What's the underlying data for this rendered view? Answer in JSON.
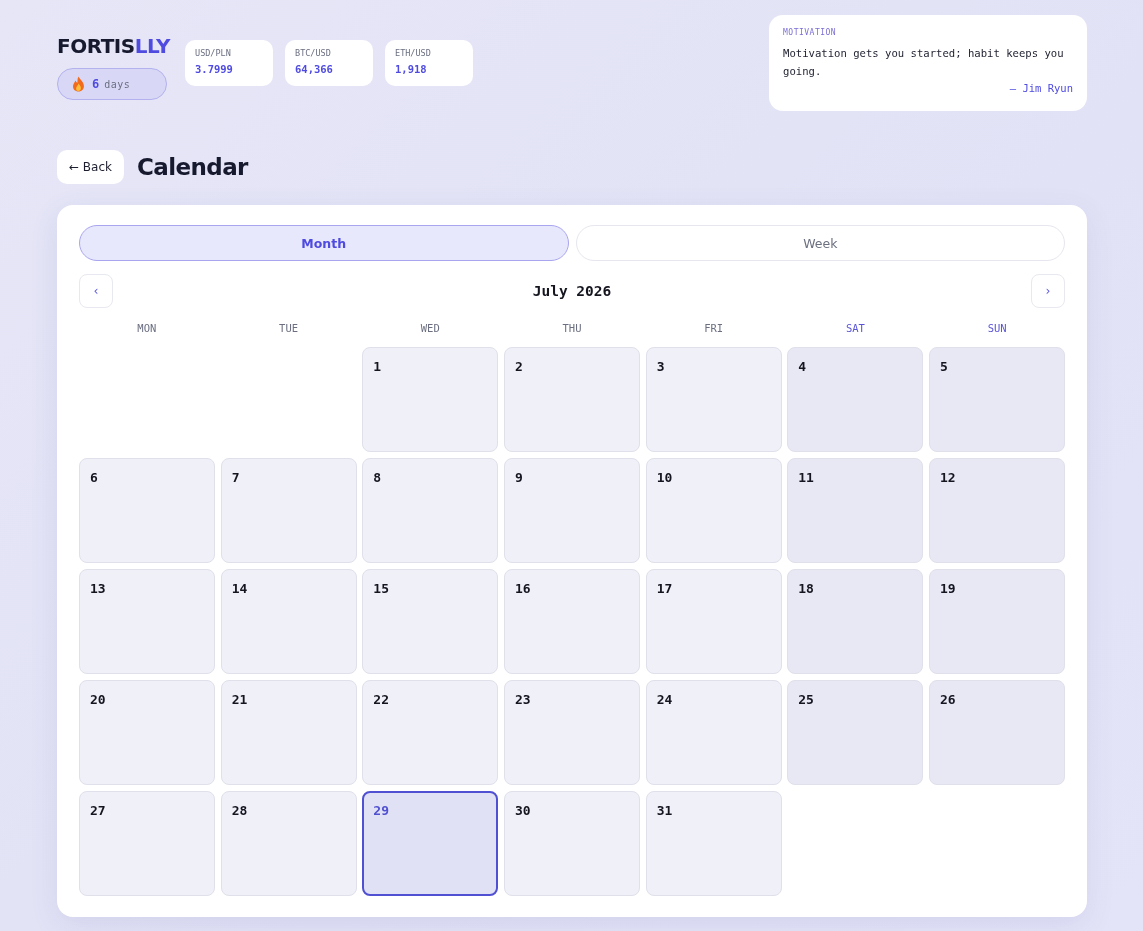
{
  "brand": {
    "name": "FORTIS",
    "accent": "LLY"
  },
  "streak": {
    "count": "6",
    "unit": "days"
  },
  "tickers": [
    {
      "label": "USD/PLN",
      "value": "3.7999"
    },
    {
      "label": "BTC/USD",
      "value": "64,366"
    },
    {
      "label": "ETH/USD",
      "value": "1,918"
    }
  ],
  "motivation": {
    "label": "MOTIVATION",
    "quote": "Motivation gets you started; habit keeps you going.",
    "author": "— Jim Ryun"
  },
  "back_button": "← Back",
  "page_title": "Calendar",
  "view_tabs": [
    {
      "label": "Month",
      "selected": true
    },
    {
      "label": "Week",
      "selected": false
    }
  ],
  "month_nav": {
    "prev": "‹",
    "title": "July 2026",
    "next": "›"
  },
  "weekdays": [
    {
      "label": "MON",
      "weekend": false
    },
    {
      "label": "TUE",
      "weekend": false
    },
    {
      "label": "WED",
      "weekend": false
    },
    {
      "label": "THU",
      "weekend": false
    },
    {
      "label": "FRI",
      "weekend": false
    },
    {
      "label": "SAT",
      "weekend": true
    },
    {
      "label": "SUN",
      "weekend": true
    }
  ],
  "weeks": [
    [
      {
        "kind": "blank"
      },
      {
        "kind": "blank"
      },
      {
        "kind": "day",
        "label": "1",
        "selected": false
      },
      {
        "kind": "day",
        "label": "2",
        "selected": false
      },
      {
        "kind": "day",
        "label": "3",
        "selected": false
      },
      {
        "kind": "day",
        "label": "4",
        "selected": false
      },
      {
        "kind": "day",
        "label": "5",
        "selected": false
      }
    ],
    [
      {
        "kind": "day",
        "label": "6",
        "selected": false
      },
      {
        "kind": "day",
        "label": "7",
        "selected": false
      },
      {
        "kind": "day",
        "label": "8",
        "selected": false
      },
      {
        "kind": "day",
        "label": "9",
        "selected": false
      },
      {
        "kind": "day",
        "label": "10",
        "selected": false
      },
      {
        "kind": "day",
        "label": "11",
        "selected": false
      },
      {
        "kind": "day",
        "label": "12",
        "selected": false
      }
    ],
    [
      {
        "kind": "day",
        "label": "13",
        "selected": false
      },
      {
        "kind": "day",
        "label": "14",
        "selected": false
      },
      {
        "kind": "day",
        "label": "15",
        "selected": false
      },
      {
        "kind": "day",
        "label": "16",
        "selected": false
      },
      {
        "kind": "day",
        "label": "17",
        "selected": false
      },
      {
        "kind": "day",
        "label": "18",
        "selected": false
      },
      {
        "kind": "day",
        "label": "19",
        "selected": false
      }
    ],
    [
      {
        "kind": "day",
        "label": "20",
        "selected": false
      },
      {
        "kind": "day",
        "label": "21",
        "selected": false
      },
      {
        "kind": "day",
        "label": "22",
        "selected": false
      },
      {
        "kind": "day",
        "label": "23",
        "selected": false
      },
      {
        "kind": "day",
        "label": "24",
        "selected": false
      },
      {
        "kind": "day",
        "label": "25",
        "selected": false
      },
      {
        "kind": "day",
        "label": "26",
        "selected": false
      }
    ],
    [
      {
        "kind": "day",
        "label": "27",
        "selected": false
      },
      {
        "kind": "day",
        "label": "28",
        "selected": false
      },
      {
        "kind": "day",
        "label": "29",
        "selected": true
      },
      {
        "kind": "day",
        "label": "30",
        "selected": false
      },
      {
        "kind": "day",
        "label": "31",
        "selected": false
      },
      {
        "kind": "blank"
      },
      {
        "kind": "blank"
      }
    ]
  ]
}
